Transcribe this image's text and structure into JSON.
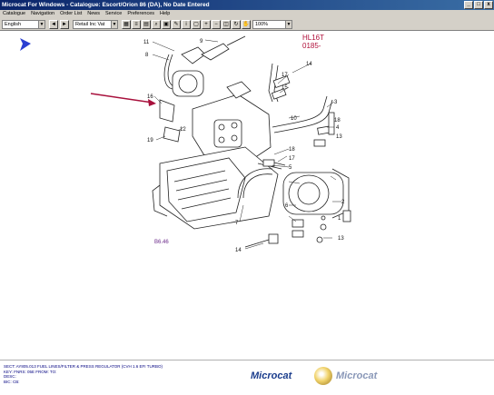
{
  "window": {
    "title": "Microcat For Windows - Catalogue: Escort/Orion 86 (DA), No Date Entered",
    "min": "_",
    "max": "□",
    "close": "x"
  },
  "menu": [
    "Catalogue",
    "Navigation",
    "Order List",
    "News",
    "Service",
    "Preferences",
    "Help"
  ],
  "toolbar": {
    "language": "English",
    "price_mode": "Retail Inc Vat",
    "zoom": "100%"
  },
  "diagram": {
    "ref_code_1": "HL16T",
    "ref_code_2": "0185-",
    "ref_code_3": "B6.46",
    "callouts": [
      "11",
      "9",
      "8",
      "16",
      "12",
      "19",
      "10",
      "14",
      "17",
      "15",
      "3",
      "18",
      "4",
      "13",
      "18",
      "2",
      "1",
      "7",
      "5",
      "6",
      "17",
      "13",
      "14"
    ]
  },
  "footer": {
    "line1": "SECT: AY805.013    FUEL LINES/FILTER & PRESS REGULATOR (CVH 1.6 EFI TURBO)",
    "line2": "KEY:          FNRS:          05E      FROM:          TO:",
    "line3": "DESC:",
    "line4": "BIC: CB:",
    "logo_left": "Microcat",
    "logo_right": "Microcat"
  }
}
